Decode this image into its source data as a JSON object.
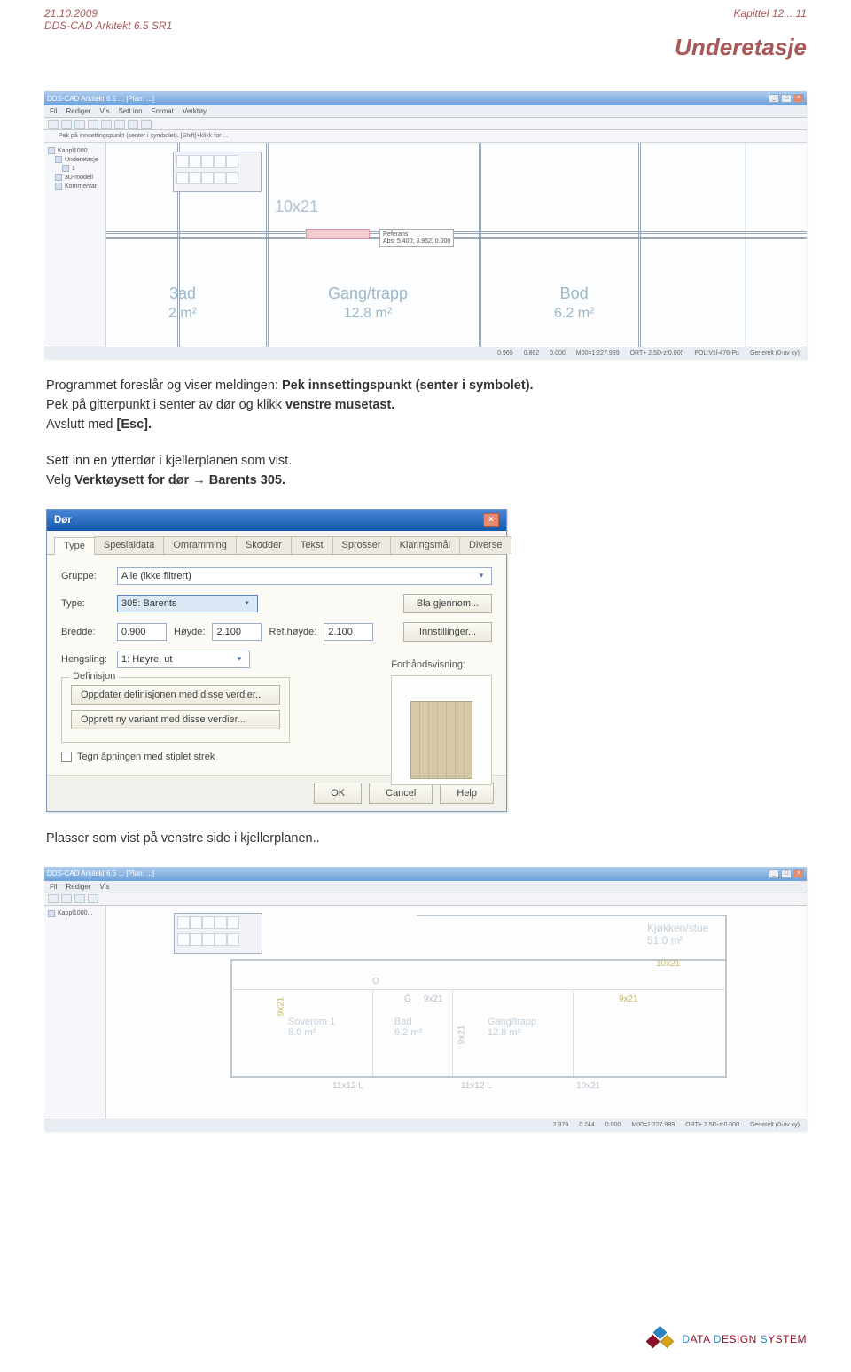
{
  "header": {
    "date": "21.10.2009",
    "product": "DDS-CAD Arkitekt  6.5 SR1",
    "chapter": "Kapittel 12... 11"
  },
  "section_title": "Underetasje",
  "screenshot1": {
    "titlebar": "DDS-CAD Arkitekt 6.5 ...  [Plan: ...]",
    "menubar": [
      "Fil",
      "Rediger",
      "Vis",
      "Sett inn",
      "Format",
      "Verktøy"
    ],
    "statusrow": "Pek på innsettingspunkt (senter i symbolet), [Shift]+klikk for ...",
    "tree": [
      "Kappl1000...",
      "Underetasje",
      "1",
      "3D-modell",
      "Kommentar"
    ],
    "door_label": "10x21",
    "rooms": {
      "bad": "3ad",
      "bad_area": "2 m²",
      "gang": "Gang/trapp",
      "gang_area": "12.8 m²",
      "bod": "Bod",
      "bod_area": "6.2 m²"
    },
    "cursor": {
      "label": "Referans",
      "coords": "Abs: 5.400; 3.962; 0.000"
    },
    "statusbar": [
      "0.965",
      "0.862",
      "0.000",
      "M00=1:227.989",
      "ORT+  2.5D-z:0.000",
      "POL:Vxl-476-Pu",
      "Generelt (0-av xy)"
    ]
  },
  "paragraph1": {
    "t1": "Programmet foreslår og viser meldingen: ",
    "bold1": "Pek innsettingspunkt (senter i symbolet).",
    "t2": "Pek på gitterpunkt i senter av dør og klikk ",
    "bold2": "venstre musetast.",
    "t3": "Avslutt med ",
    "bold3": "[Esc]."
  },
  "paragraph2": {
    "t1": "Sett inn en ytterdør i kjellerplanen som vist.",
    "t2": "Velg ",
    "bold1": "Verktøysett for dør → Barents 305."
  },
  "dialog": {
    "title": "Dør",
    "tabs": [
      "Type",
      "Spesialdata",
      "Omramming",
      "Skodder",
      "Tekst",
      "Sprosser",
      "Klaringsmål",
      "Diverse"
    ],
    "labels": {
      "gruppe": "Gruppe:",
      "type": "Type:",
      "bredde": "Bredde:",
      "hoyde": "Høyde:",
      "ref": "Ref.høyde:",
      "hengsling": "Hengsling:",
      "preview": "Forhåndsvisning:"
    },
    "values": {
      "gruppe": "Alle (ikke filtrert)",
      "type": "305: Barents",
      "bredde": "0.900",
      "hoyde": "2.100",
      "ref": "2.100",
      "hengsling": "1: Høyre, ut"
    },
    "buttons": {
      "bla": "Bla gjennom...",
      "inn": "Innstillinger...",
      "opp": "Oppdater definisjonen med disse verdier...",
      "ny": "Opprett ny variant med disse verdier..."
    },
    "fieldset": "Definisjon",
    "checkbox": "Tegn åpningen med stiplet strek",
    "footer": {
      "ok": "OK",
      "cancel": "Cancel",
      "help": "Help"
    }
  },
  "paragraph3": "Plasser som vist på venstre side i kjellerplanen..",
  "screenshot2": {
    "rooms": {
      "kjokken": "Kjøkken/stue",
      "kjokken_area": "51.0 m²",
      "sov": "Soverom 1",
      "sov_area": "8.0 m²",
      "bad": "Bad",
      "bad_area": "6.2 m²",
      "gang": "Gang/trapp",
      "gang_area": "12.8 m²"
    },
    "doors": {
      "y_10x21_top": "10x21",
      "y_9x21_right1": "9x21",
      "y_9x21_left_vert": "9x21",
      "g_9x21_center": "9x21",
      "g_9x21_small_vert": "9x21",
      "g_letter": "G",
      "g_circle": "O"
    },
    "dims": [
      "11x12 L",
      "11x12 L",
      "10x21"
    ],
    "statusbar": [
      "2.379",
      "0.244",
      "0.000",
      "M00=1:227.989",
      "ORT+  2.5D-z:0.000",
      "Generelt (0-av xy)"
    ]
  },
  "footer_brand": "DATA DESIGN SYSTEM"
}
